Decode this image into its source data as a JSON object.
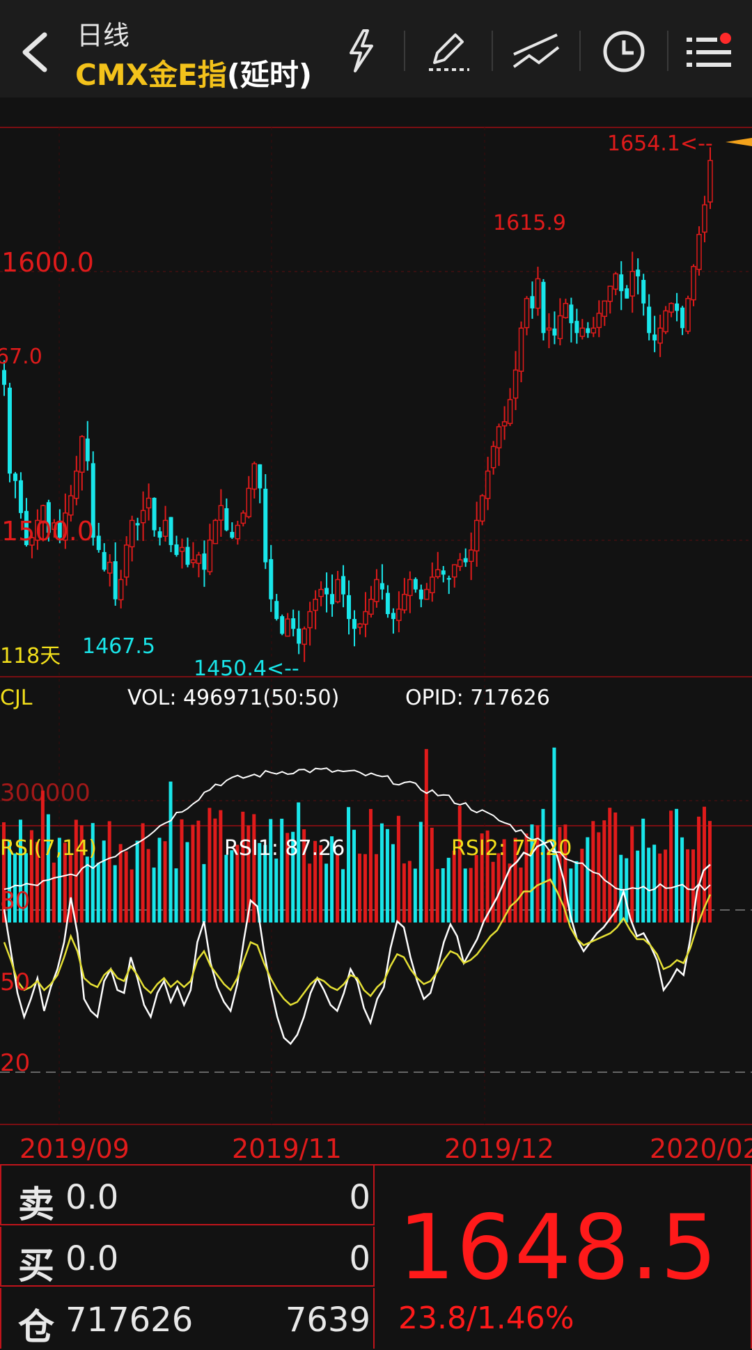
{
  "header": {
    "subtitle": "日线",
    "title_main": "CMX金E指",
    "title_delay": "(延时)",
    "icons": [
      "back-arrow-icon",
      "lightning-icon",
      "pen-draw-icon",
      "trendline-icon",
      "clock-icon",
      "menu-list-icon"
    ]
  },
  "main_chart": {
    "high_label": "1654.1<--",
    "peak_label": "1615.9",
    "left_label": "67.0",
    "low_label_a": "1467.5",
    "low_label_b": "1450.4<--",
    "days_label": "118天",
    "price_axis": [
      "1600.0",
      "1500.0"
    ]
  },
  "volume_panel": {
    "name": "CJL",
    "vol": "VOL: 496971(50:50)",
    "opid": "OPID: 717626",
    "axis_label": "300000"
  },
  "rsi_panel": {
    "name": "RSI(7,14)",
    "rsi1": "RSI1: 87.26",
    "rsi2": "RSI2: 77.20",
    "levels": [
      "80",
      "50",
      "20"
    ]
  },
  "dates": [
    "2019/09",
    "2019/11",
    "2019/12",
    "2020/02"
  ],
  "quote": {
    "sell_label": "卖",
    "sell_price": "0.0",
    "sell_qty": "0",
    "buy_label": "买",
    "buy_price": "0.0",
    "buy_qty": "0",
    "oi_label": "仓",
    "oi_value": "717626",
    "oi_change": "7639",
    "last_price": "1648.5",
    "change": "23.8/1.46%"
  },
  "colors": {
    "up": "#e01b1b",
    "down": "#19e6ea",
    "accent": "#f3c21b"
  },
  "chart_data": {
    "type": "candlestick",
    "price_range": [
      1440,
      1660
    ],
    "rsi_range": [
      0,
      100
    ],
    "candles_close": [
      1557,
      1521,
      1518,
      1505,
      1492,
      1495,
      1502,
      1508,
      1497,
      1501,
      1495,
      1505,
      1512,
      1522,
      1536,
      1526,
      1495,
      1490,
      1482,
      1485,
      1470,
      1478,
      1492,
      1502,
      1500,
      1506,
      1511,
      1498,
      1495,
      1502,
      1492,
      1488,
      1491,
      1484,
      1486,
      1488,
      1482,
      1494,
      1502,
      1508,
      1498,
      1495,
      1500,
      1505,
      1515,
      1525,
      1515,
      1485,
      1470,
      1462,
      1456,
      1462,
      1458,
      1452,
      1458,
      1465,
      1470,
      1474,
      1472,
      1468,
      1478,
      1472,
      1462,
      1458,
      1460,
      1465,
      1470,
      1478,
      1474,
      1464,
      1462,
      1466,
      1472,
      1478,
      1474,
      1470,
      1474,
      1479,
      1482,
      1480,
      1478,
      1484,
      1486,
      1485,
      1490,
      1502,
      1512,
      1522,
      1532,
      1540,
      1542,
      1551,
      1563,
      1580,
      1592,
      1588,
      1600,
      1578,
      1580,
      1577,
      1585,
      1590,
      1582,
      1578,
      1580,
      1578,
      1580,
      1586,
      1591,
      1597,
      1602,
      1595,
      1592,
      1603,
      1601,
      1590,
      1578,
      1575,
      1580,
      1587,
      1590,
      1587,
      1580,
      1592,
      1605,
      1618,
      1630,
      1648
    ],
    "rsi1_values": [
      72,
      58,
      44,
      36,
      42,
      49,
      38,
      46,
      52,
      61,
      76,
      64,
      42,
      38,
      36,
      48,
      52,
      45,
      44,
      56,
      49,
      40,
      36,
      44,
      48,
      41,
      46,
      40,
      45,
      61,
      68,
      54,
      46,
      41,
      38,
      47,
      62,
      75,
      73,
      58,
      46,
      36,
      29,
      27,
      30,
      36,
      44,
      49,
      45,
      40,
      38,
      44,
      52,
      48,
      39,
      34,
      42,
      46,
      59,
      68,
      66,
      56,
      48,
      42,
      44,
      52,
      61,
      67,
      63,
      54,
      58,
      62,
      68,
      72,
      76,
      81,
      86,
      88,
      91,
      90,
      93,
      94,
      95,
      90,
      82,
      70,
      62,
      58,
      61,
      64,
      66,
      69,
      72,
      78,
      69,
      63,
      64,
      60,
      55,
      45,
      48,
      52,
      50,
      62,
      78,
      85,
      87
    ],
    "rsi2_values": [
      61,
      55,
      48,
      45,
      46,
      48,
      45,
      47,
      50,
      56,
      63,
      58,
      49,
      47,
      46,
      50,
      52,
      49,
      48,
      53,
      50,
      46,
      44,
      47,
      49,
      46,
      48,
      46,
      48,
      55,
      58,
      53,
      50,
      47,
      45,
      49,
      55,
      61,
      60,
      54,
      49,
      45,
      42,
      40,
      41,
      44,
      47,
      49,
      48,
      46,
      45,
      47,
      50,
      49,
      45,
      43,
      46,
      48,
      53,
      57,
      56,
      52,
      49,
      47,
      48,
      51,
      55,
      58,
      57,
      54,
      55,
      57,
      60,
      63,
      65,
      69,
      73,
      75,
      78,
      78,
      80,
      81,
      82,
      78,
      73,
      66,
      62,
      60,
      61,
      62,
      63,
      64,
      66,
      69,
      65,
      62,
      62,
      60,
      57,
      52,
      53,
      55,
      54,
      59,
      66,
      72,
      77
    ],
    "volume_max": 600000,
    "opid_range": [
      400000,
      760000
    ]
  }
}
